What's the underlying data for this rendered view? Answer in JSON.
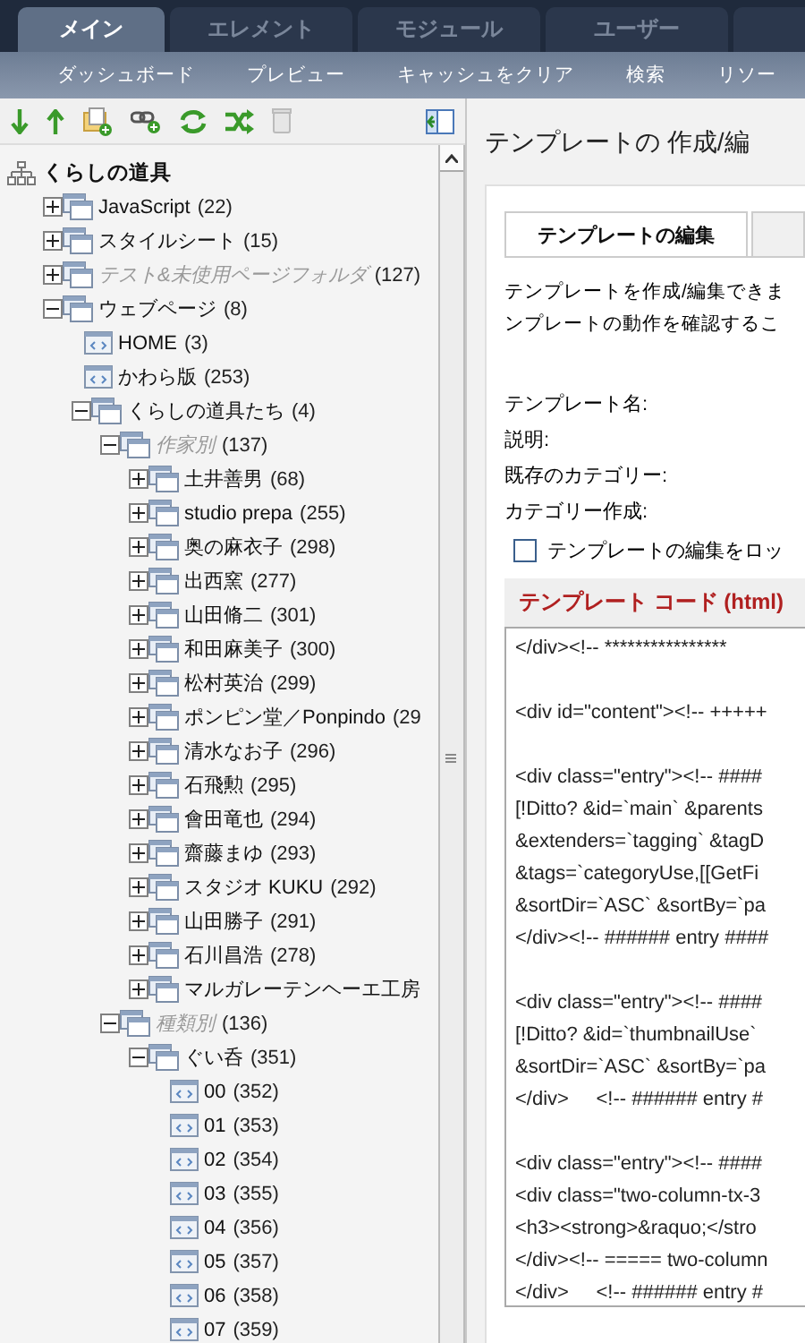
{
  "main_tabs": [
    {
      "label": "メイン",
      "selected": true
    },
    {
      "label": "エレメント",
      "selected": false
    },
    {
      "label": "モジュール",
      "selected": false
    },
    {
      "label": "ユーザー",
      "selected": false
    }
  ],
  "sub_nav": [
    "ダッシュボード",
    "プレビュー",
    "キャッシュをクリア",
    "検索",
    "リソー"
  ],
  "tree": {
    "label": "くらしの道具",
    "children": [
      {
        "kind": "folder",
        "label": "JavaScript",
        "count": "(22)",
        "expanded": false,
        "muted": false
      },
      {
        "kind": "folder",
        "label": "スタイルシート",
        "count": "(15)",
        "expanded": false,
        "muted": false
      },
      {
        "kind": "folder",
        "label": "テスト&未使用ページフォルダ",
        "count": "(127)",
        "expanded": false,
        "muted": true
      },
      {
        "kind": "folder",
        "label": "ウェブページ",
        "count": "(8)",
        "expanded": true,
        "muted": false,
        "children": [
          {
            "kind": "page",
            "label": "HOME",
            "count": "(3)",
            "muted": false
          },
          {
            "kind": "page",
            "label": "かわら版",
            "count": "(253)",
            "muted": false
          },
          {
            "kind": "folder",
            "label": "くらしの道具たち",
            "count": "(4)",
            "expanded": true,
            "muted": false,
            "children": [
              {
                "kind": "folder",
                "label": "作家別",
                "count": "(137)",
                "expanded": true,
                "muted": true,
                "children": [
                  {
                    "kind": "folder",
                    "label": "土井善男",
                    "count": "(68)",
                    "expanded": false,
                    "muted": false
                  },
                  {
                    "kind": "folder",
                    "label": "studio prepa",
                    "count": "(255)",
                    "expanded": false,
                    "muted": false
                  },
                  {
                    "kind": "folder",
                    "label": "奥の麻衣子",
                    "count": "(298)",
                    "expanded": false,
                    "muted": false
                  },
                  {
                    "kind": "folder",
                    "label": "出西窯",
                    "count": "(277)",
                    "expanded": false,
                    "muted": false
                  },
                  {
                    "kind": "folder",
                    "label": "山田脩二",
                    "count": "(301)",
                    "expanded": false,
                    "muted": false
                  },
                  {
                    "kind": "folder",
                    "label": "和田麻美子",
                    "count": "(300)",
                    "expanded": false,
                    "muted": false
                  },
                  {
                    "kind": "folder",
                    "label": "松村英治",
                    "count": "(299)",
                    "expanded": false,
                    "muted": false
                  },
                  {
                    "kind": "folder",
                    "label": "ポンピン堂／Ponpindo",
                    "count": "(29",
                    "expanded": false,
                    "muted": false
                  },
                  {
                    "kind": "folder",
                    "label": "清水なお子",
                    "count": "(296)",
                    "expanded": false,
                    "muted": false
                  },
                  {
                    "kind": "folder",
                    "label": "石飛勲",
                    "count": "(295)",
                    "expanded": false,
                    "muted": false
                  },
                  {
                    "kind": "folder",
                    "label": "會田竜也",
                    "count": "(294)",
                    "expanded": false,
                    "muted": false
                  },
                  {
                    "kind": "folder",
                    "label": "齋藤まゆ",
                    "count": "(293)",
                    "expanded": false,
                    "muted": false
                  },
                  {
                    "kind": "folder",
                    "label": "スタジオ KUKU",
                    "count": "(292)",
                    "expanded": false,
                    "muted": false
                  },
                  {
                    "kind": "folder",
                    "label": "山田勝子",
                    "count": "(291)",
                    "expanded": false,
                    "muted": false
                  },
                  {
                    "kind": "folder",
                    "label": "石川昌浩",
                    "count": "(278)",
                    "expanded": false,
                    "muted": false
                  },
                  {
                    "kind": "folder",
                    "label": "マルガレーテンヘーエ工房",
                    "expanded": false,
                    "muted": false
                  }
                ]
              },
              {
                "kind": "folder",
                "label": "種類別",
                "count": "(136)",
                "expanded": true,
                "muted": true,
                "children": [
                  {
                    "kind": "folder",
                    "label": "ぐい呑",
                    "count": "(351)",
                    "expanded": true,
                    "muted": false,
                    "children": [
                      {
                        "kind": "page",
                        "label": "00",
                        "count": "(352)",
                        "muted": false
                      },
                      {
                        "kind": "page",
                        "label": "01",
                        "count": "(353)",
                        "muted": false
                      },
                      {
                        "kind": "page",
                        "label": "02",
                        "count": "(354)",
                        "muted": false
                      },
                      {
                        "kind": "page",
                        "label": "03",
                        "count": "(355)",
                        "muted": false
                      },
                      {
                        "kind": "page",
                        "label": "04",
                        "count": "(356)",
                        "muted": false
                      },
                      {
                        "kind": "page",
                        "label": "05",
                        "count": "(357)",
                        "muted": false
                      },
                      {
                        "kind": "page",
                        "label": "06",
                        "count": "(358)",
                        "muted": false
                      },
                      {
                        "kind": "page",
                        "label": "07",
                        "count": "(359)",
                        "muted": false
                      }
                    ]
                  }
                ]
              }
            ]
          }
        ]
      }
    ]
  },
  "page_title": "テンプレートの 作成/編",
  "editor_tabs": [
    {
      "label": "テンプレートの編集",
      "selected": true
    },
    {
      "selected": false
    }
  ],
  "description": [
    "テンプレートを作成/編集できま",
    "ンプレートの動作を確認するこ"
  ],
  "fields": [
    "テンプレート名:",
    "説明:",
    "既存のカテゴリー:",
    "カテゴリー作成:"
  ],
  "lock_checkbox": {
    "label": "テンプレートの編集をロッ",
    "checked": false
  },
  "code_section": {
    "title": "テンプレート コード (html)",
    "blocks": [
      [
        "</div><!-- ****************"
      ],
      [
        "<div id=\"content\"><!-- +++++"
      ],
      [
        "<div class=\"entry\"><!-- ####",
        "[!Ditto? &id=`main` &parents",
        "&extenders=`tagging` &tagD",
        "&tags=`categoryUse,[[GetFi",
        "&sortDir=`ASC` &sortBy=`pa",
        "</div><!-- ###### entry ####"
      ],
      [
        "<div class=\"entry\"><!-- ####",
        "[!Ditto? &id=`thumbnailUse`",
        "&sortDir=`ASC` &sortBy=`pa",
        "</div>     <!-- ###### entry #"
      ],
      [
        "<div class=\"entry\"><!-- ####",
        "<div class=\"two-column-tx-3",
        "<h3><strong>&raquo;</stro",
        "</div><!-- ===== two-column",
        "</div>     <!-- ###### entry #"
      ]
    ]
  }
}
